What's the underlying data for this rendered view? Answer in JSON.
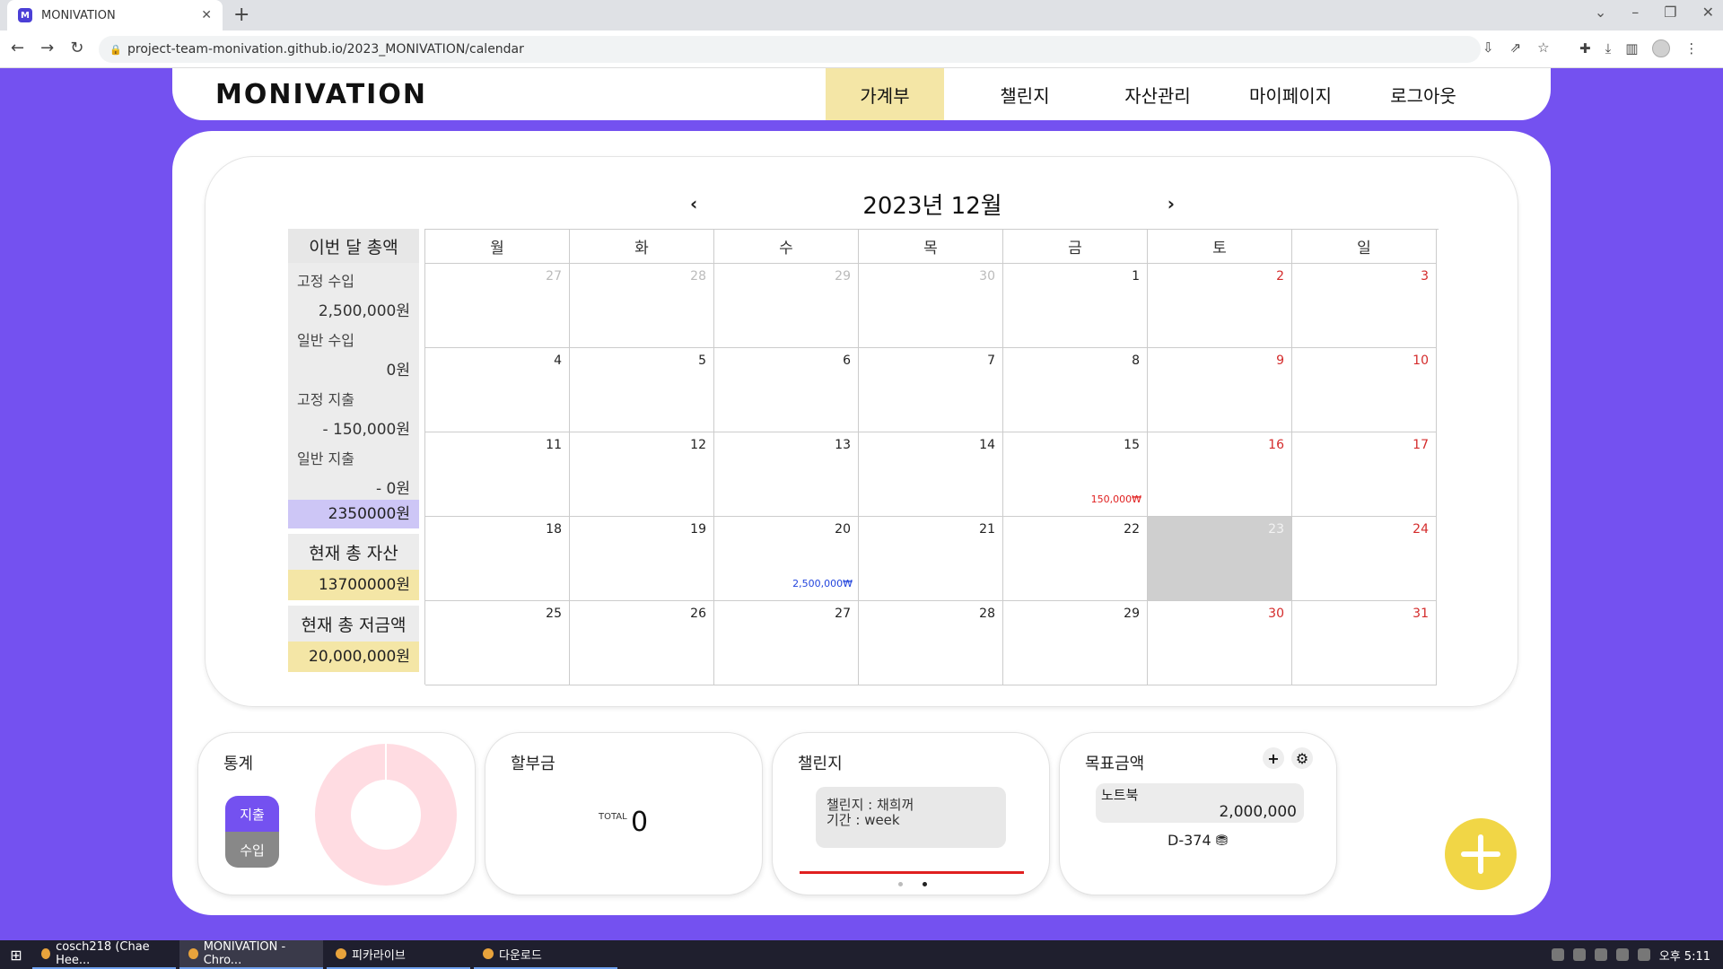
{
  "browser": {
    "tab_title": "MONIVATION",
    "url": "project-team-monivation.github.io/2023_MONIVATION/calendar"
  },
  "header": {
    "logo": "MONIVATION",
    "nav": [
      "가계부",
      "챌린지",
      "자산관리",
      "마이페이지",
      "로그아웃"
    ]
  },
  "calendar": {
    "month_label": "2023년 12월",
    "prev": "‹",
    "next": "›",
    "weekdays": [
      "월",
      "화",
      "수",
      "목",
      "금",
      "토",
      "일"
    ],
    "weeks": [
      [
        "27",
        "28",
        "29",
        "30",
        "1",
        "2",
        "3"
      ],
      [
        "4",
        "5",
        "6",
        "7",
        "8",
        "9",
        "10"
      ],
      [
        "11",
        "12",
        "13",
        "14",
        "15",
        "16",
        "17"
      ],
      [
        "18",
        "19",
        "20",
        "21",
        "22",
        "23",
        "24"
      ],
      [
        "25",
        "26",
        "27",
        "28",
        "29",
        "30",
        "31"
      ]
    ],
    "expense_15": "150,000₩",
    "income_20": "2,500,000₩"
  },
  "summary": {
    "title": "이번 달 총액",
    "fixed_income_label": "고정 수입",
    "fixed_income": "2,500,000원",
    "general_income_label": "일반 수입",
    "general_income": "0원",
    "fixed_expense_label": "고정 지출",
    "fixed_expense": "- 150,000원",
    "general_expense_label": "일반 지출",
    "general_expense": "- 0원",
    "total": "2350000원",
    "assets_title": "현재 총 자산",
    "assets": "13700000원",
    "savings_title": "현재 총 저금액",
    "savings": "20,000,000원"
  },
  "widgets": {
    "stats": {
      "title": "통계",
      "expense": "지출",
      "income": "수입"
    },
    "installment": {
      "title": "할부금",
      "total_label": "TOTAL",
      "total": "0"
    },
    "challenge": {
      "title": "챌린지",
      "line1": "챌린지 : 채희꺼",
      "line2": "기간 : week"
    },
    "goal": {
      "title": "목표금액",
      "add": "+",
      "settings": "⚙",
      "item_name": "노트북",
      "item_amount": "2,000,000",
      "dday": "D-374 ⛃"
    }
  },
  "taskbar": {
    "items": [
      "cosch218 (Chae Hee...",
      "MONIVATION - Chro...",
      "피카라이브",
      "다운로드"
    ],
    "clock": "오후 5:11"
  }
}
